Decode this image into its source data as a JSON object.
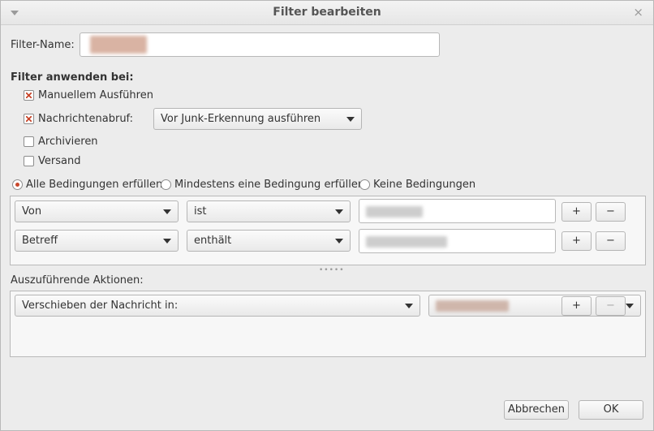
{
  "window": {
    "title": "Filter bearbeiten",
    "close_glyph": "×"
  },
  "filter_name": {
    "label": "Filter-Name:",
    "value": ""
  },
  "apply": {
    "heading": "Filter anwenden bei:",
    "options": [
      {
        "label": "Manuellem Ausführen",
        "checked": true
      },
      {
        "label": "Nachrichtenabruf:",
        "checked": true
      },
      {
        "label": "Archivieren",
        "checked": false
      },
      {
        "label": "Versand",
        "checked": false
      }
    ],
    "timing": "Vor Junk-Erkennung ausführen"
  },
  "match": {
    "options": [
      {
        "label": "Alle Bedingungen erfüllen",
        "selected": true
      },
      {
        "label": "Mindestens eine Bedingung erfüllen",
        "selected": false
      },
      {
        "label": "Keine Bedingungen",
        "selected": false
      }
    ]
  },
  "conditions": [
    {
      "field": "Von",
      "operator": "ist",
      "value": "",
      "add": "+",
      "remove": "−"
    },
    {
      "field": "Betreff",
      "operator": "enthält",
      "value": "",
      "add": "+",
      "remove": "−"
    }
  ],
  "actions": {
    "heading": "Auszuführende Aktionen:",
    "rows": [
      {
        "action": "Verschieben der Nachricht in:",
        "target": "",
        "add": "+",
        "remove": "−"
      }
    ]
  },
  "buttons": {
    "cancel": "Abbrechen",
    "ok": "OK"
  }
}
